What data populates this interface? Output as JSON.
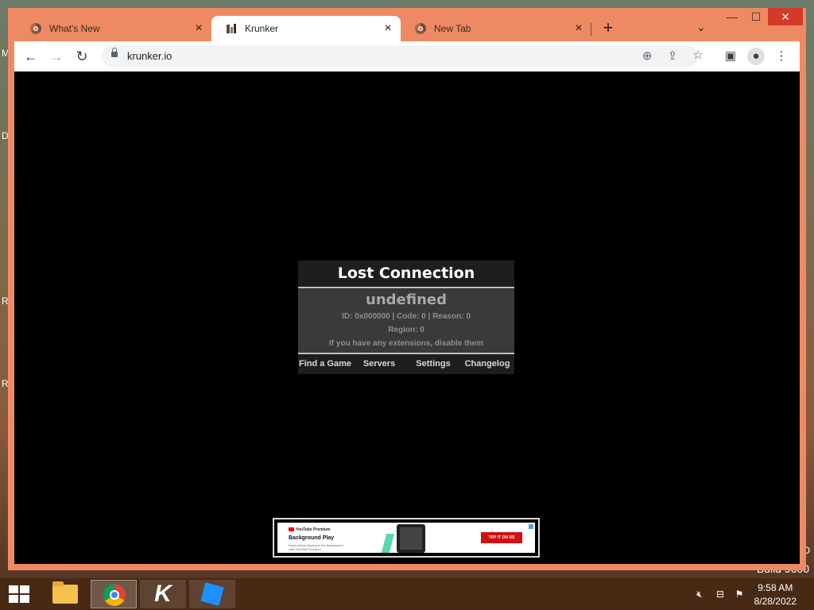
{
  "desktop": {
    "edge_letters": [
      "M",
      "D",
      "R",
      "R"
    ],
    "build_label": "Build 9600",
    "edge_right": "D"
  },
  "browser": {
    "tabs": [
      {
        "title": "What's New",
        "active": false
      },
      {
        "title": "Krunker",
        "active": true
      },
      {
        "title": "New Tab",
        "active": false
      }
    ],
    "new_tab_symbol": "+",
    "tab_search_symbol": "⌄",
    "window_controls": {
      "minimize": "—",
      "maximize": "☐",
      "close": "✕"
    },
    "toolbar": {
      "back": "←",
      "forward": "→",
      "reload": "↻",
      "url": "krunker.io"
    }
  },
  "game": {
    "dialog": {
      "title": "Lost Connection",
      "message": "undefined",
      "details": "ID: 0x000000 | Code: 0 | Reason: 0",
      "region": "Region: 0",
      "hint": "If you have any extensions, disable them",
      "actions": [
        "Find a Game",
        "Servers",
        "Settings",
        "Changelog"
      ]
    },
    "ad": {
      "brand": "YouTube Premium",
      "headline": "Background Play",
      "subtext": "Keep videos playing in the background with YouTube Premium",
      "cta": "TRY IT ON US"
    }
  },
  "taskbar": {
    "clock_time": "9:58 AM",
    "clock_date": "8/28/2022",
    "apps": [
      "file-explorer",
      "chrome",
      "krunker",
      "roblox"
    ]
  }
}
